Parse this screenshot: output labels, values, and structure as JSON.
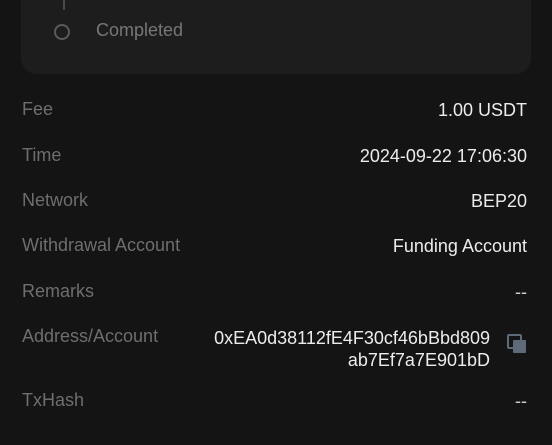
{
  "status": {
    "step_label": "Completed"
  },
  "details": {
    "fee": {
      "label": "Fee",
      "value": "1.00 USDT"
    },
    "time": {
      "label": "Time",
      "value": "2024-09-22 17:06:30"
    },
    "network": {
      "label": "Network",
      "value": "BEP20"
    },
    "withdrawal_account": {
      "label": "Withdrawal Account",
      "value": "Funding Account"
    },
    "remarks": {
      "label": "Remarks",
      "value": "--"
    },
    "address": {
      "label": "Address/Account",
      "line1": "0xEA0d38112fE4F30cf46bBbd809",
      "line2": "ab7Ef7a7E901bD"
    },
    "txhash": {
      "label": "TxHash",
      "value": "--"
    }
  },
  "icons": {
    "copy": "copy-icon"
  },
  "colors": {
    "background": "#141414",
    "card": "#1d1d1d",
    "label": "#6e6e6e",
    "value": "#ececec"
  }
}
